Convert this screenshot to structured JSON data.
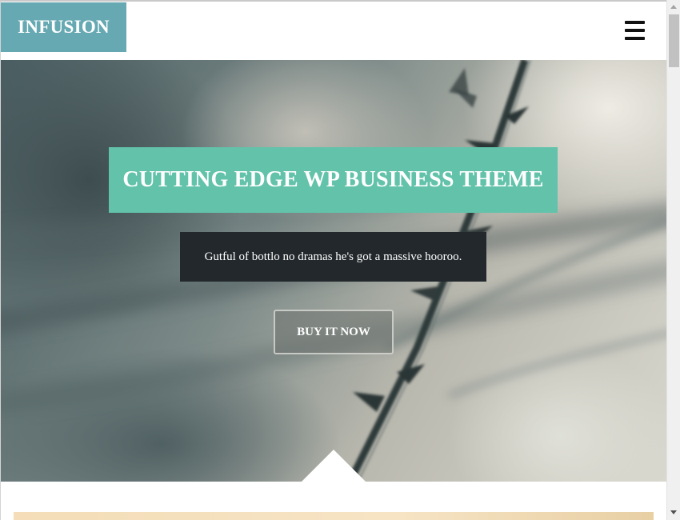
{
  "header": {
    "logo_text": "INFUSION",
    "menu_icon": "hamburger-menu-icon"
  },
  "hero": {
    "title": "CUTTING EDGE WP BUSINESS THEME",
    "subtitle": "Gutful of bottlo no dramas he's got a massive hooroo.",
    "cta_label": "BUY IT NOW"
  },
  "colors": {
    "logo_bg": "#66a9b2",
    "title_bg": "#63c2aa",
    "subtitle_bg": "#22282c"
  },
  "scrollbar": {
    "up_icon": "scroll-up-arrow-icon",
    "down_icon": "scroll-down-arrow-icon"
  }
}
